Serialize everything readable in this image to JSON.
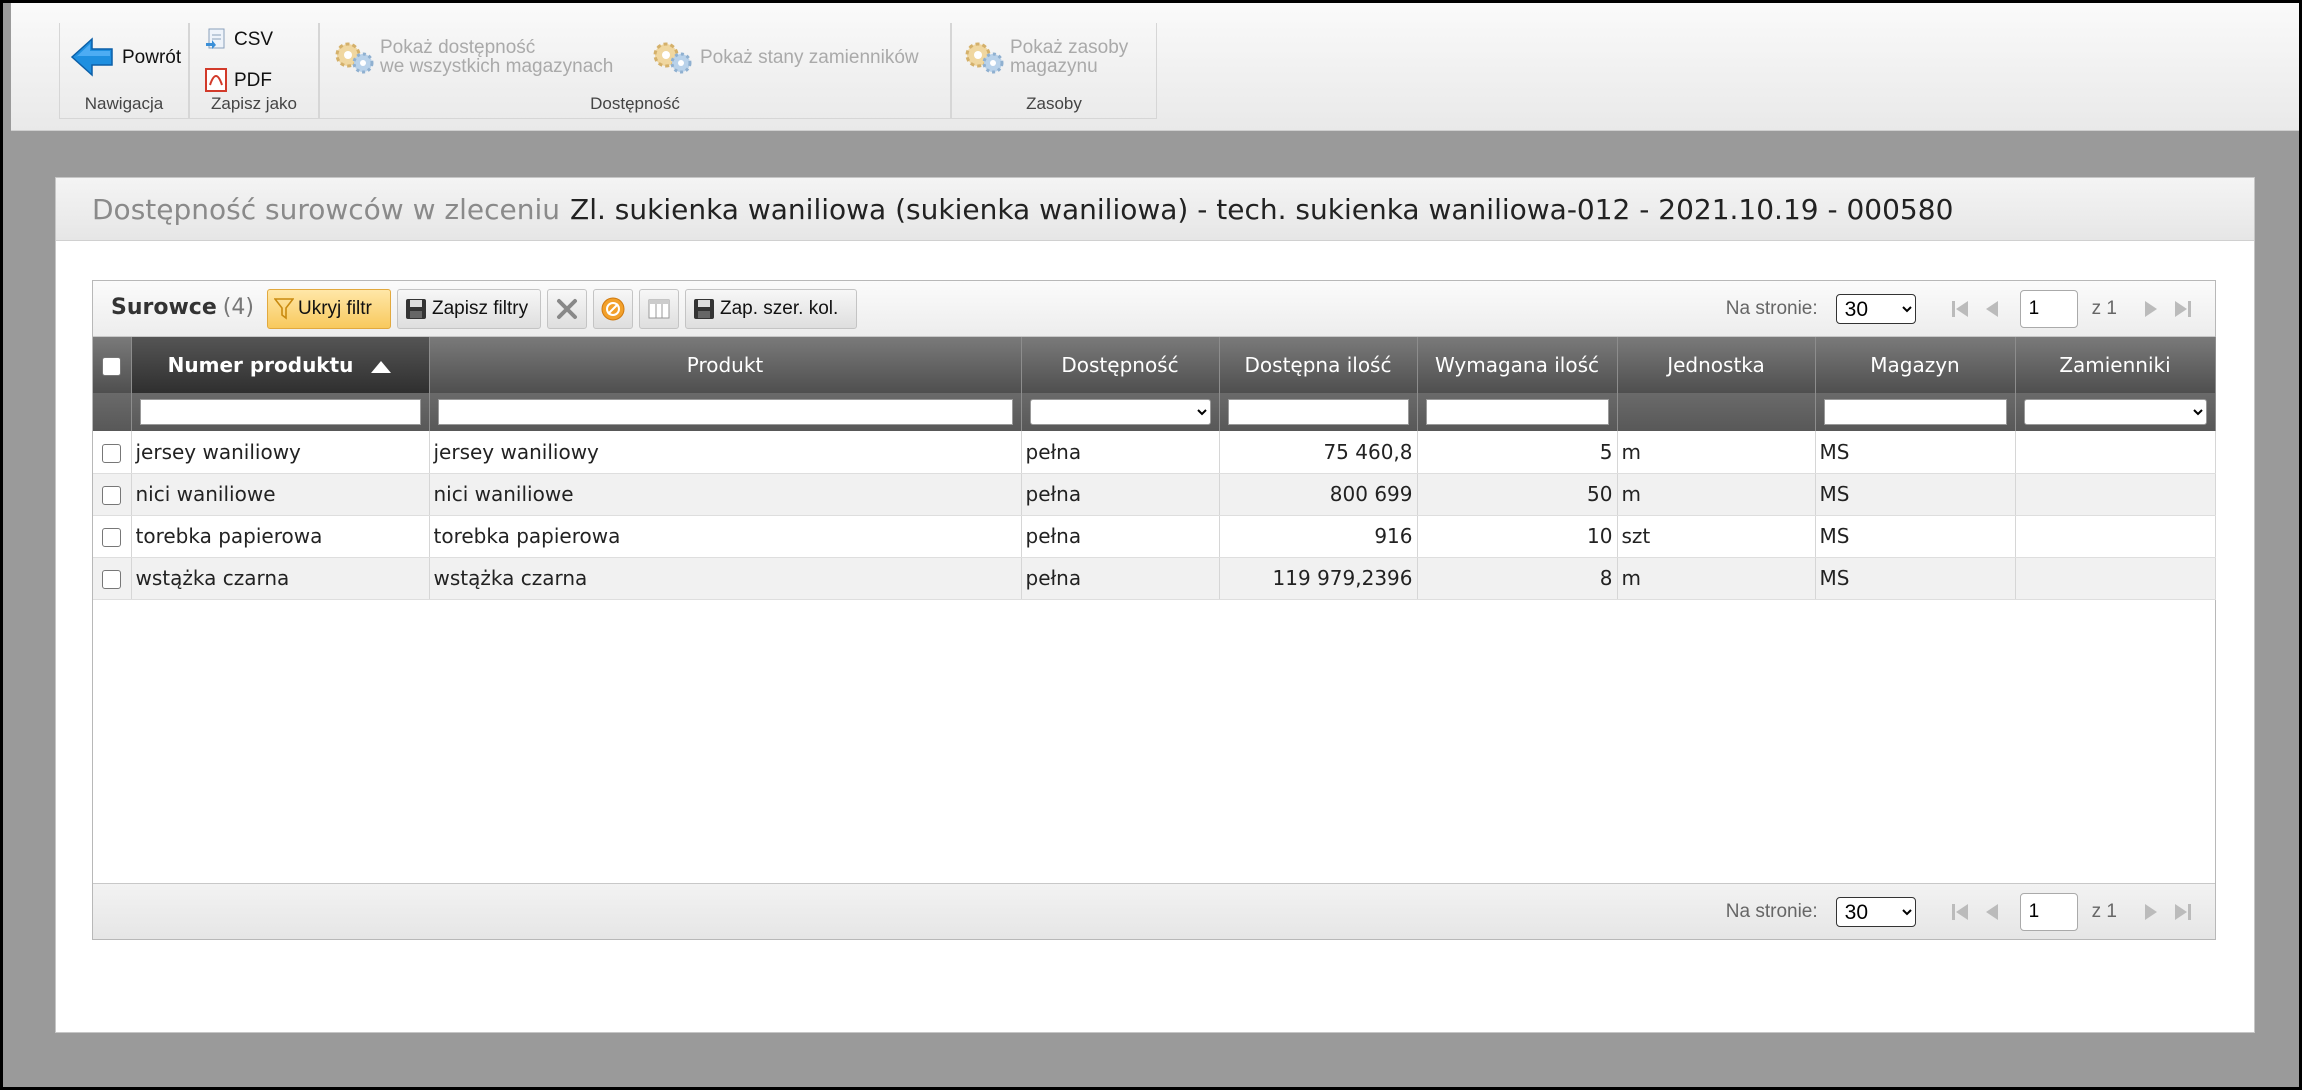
{
  "ribbon": {
    "groups": {
      "nawigacja": "Nawigacja",
      "zapisz_jako": "Zapisz jako",
      "dostepnosc": "Dostępność",
      "zasoby": "Zasoby"
    },
    "buttons": {
      "powrot": "Powrót",
      "csv": "CSV",
      "pdf": "PDF",
      "pokaz_dostepnosc_1": "Pokaż dostępność",
      "pokaz_dostepnosc_2": "we wszystkich magazynach",
      "pokaz_stany": "Pokaż stany zamienników",
      "pokaz_zasoby_1": "Pokaż zasoby",
      "pokaz_zasoby_2": "magazynu"
    }
  },
  "panel": {
    "title_prefix": "Dostępność surowców w zleceniu",
    "title": "Zl. sukienka waniliowa (sukienka waniliowa) - tech. sukienka waniliowa-012 - 2021.10.19 - 000580"
  },
  "grid": {
    "title": "Surowce",
    "count": "(4)",
    "toolbar": {
      "hide_filter": "Ukryj filtr",
      "save_filters": "Zapisz filtry",
      "save_col_widths": "Zap. szer. kol."
    },
    "pager": {
      "per_page_label": "Na stronie:",
      "per_page_value": "30",
      "page": "1",
      "of": "z 1"
    },
    "columns": [
      "Numer produktu",
      "Produkt",
      "Dostępność",
      "Dostępna ilość",
      "Wymagana ilość",
      "Jednostka",
      "Magazyn",
      "Zamienniki"
    ],
    "rows": [
      {
        "numer": "jersey waniliowy",
        "produkt": "jersey waniliowy",
        "dostepnosc": "pełna",
        "dostepna": "75 460,8",
        "wymagana": "5",
        "jednostka": "m",
        "magazyn": "MS",
        "zamienniki": ""
      },
      {
        "numer": "nici waniliowe",
        "produkt": "nici waniliowe",
        "dostepnosc": "pełna",
        "dostepna": "800 699",
        "wymagana": "50",
        "jednostka": "m",
        "magazyn": "MS",
        "zamienniki": ""
      },
      {
        "numer": "torebka papierowa",
        "produkt": "torebka papierowa",
        "dostepnosc": "pełna",
        "dostepna": "916",
        "wymagana": "10",
        "jednostka": "szt",
        "magazyn": "MS",
        "zamienniki": ""
      },
      {
        "numer": "wstążka czarna",
        "produkt": "wstążka czarna",
        "dostepnosc": "pełna",
        "dostepna": "119 979,2396",
        "wymagana": "8",
        "jednostka": "m",
        "magazyn": "MS",
        "zamienniki": ""
      }
    ]
  },
  "colors": {
    "background": "#9a9a9a",
    "header_dark": "#4f4f4f",
    "active_button": "#f8c95d",
    "arrow_blue": "#1e8fe0",
    "pdf_red": "#d23a2a"
  }
}
